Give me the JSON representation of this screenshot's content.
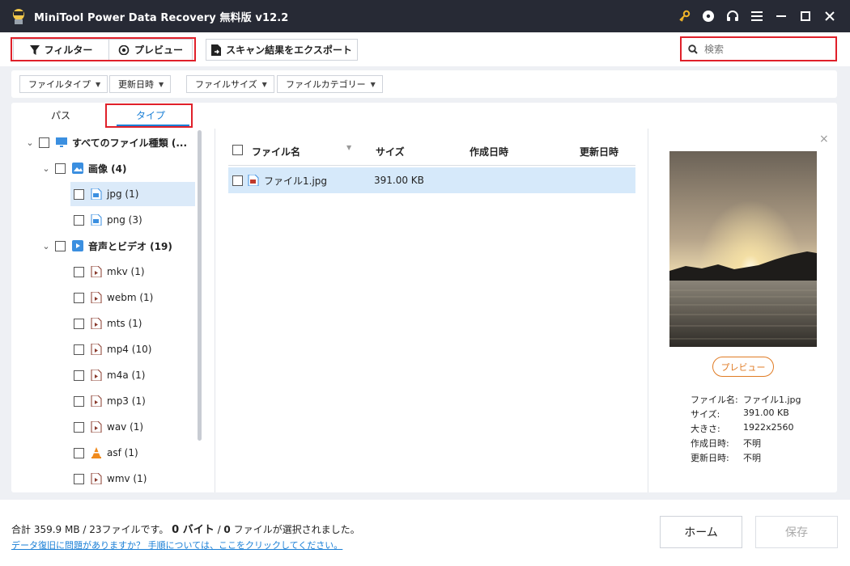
{
  "app": {
    "title": "MiniTool Power Data Recovery 無料版 v12.2"
  },
  "toolbar": {
    "filter_label": "フィルター",
    "preview_label": "プレビュー",
    "export_label": "スキャン結果をエクスポート",
    "search_placeholder": "検索"
  },
  "filters": [
    {
      "label": "ファイルタイプ"
    },
    {
      "label": "更新日時"
    },
    {
      "label": "ファイルサイズ"
    },
    {
      "label": "ファイルカテゴリー"
    }
  ],
  "tabs": {
    "path": "パス",
    "type": "タイプ"
  },
  "tree": {
    "root": "すべてのファイル種類 (...",
    "images": "画像 (4)",
    "jpg": "jpg (1)",
    "png": "png (3)",
    "av": "音声とビデオ (19)",
    "mkv": "mkv (1)",
    "webm": "webm (1)",
    "mts": "mts (1)",
    "mp4": "mp4 (10)",
    "m4a": "m4a (1)",
    "mp3": "mp3 (1)",
    "wav": "wav (1)",
    "asf": "asf (1)",
    "wmv": "wmv (1)"
  },
  "list": {
    "headers": {
      "name": "ファイル名",
      "size": "サイズ",
      "created": "作成日時",
      "modified": "更新日時"
    },
    "rows": [
      {
        "name": "ファイル1.jpg",
        "size": "391.00 KB",
        "created": "",
        "modified": ""
      }
    ]
  },
  "preview": {
    "button": "プレビュー",
    "labels": {
      "name": "ファイル名:",
      "size": "サイズ:",
      "dims": "大きさ:",
      "created": "作成日時:",
      "modified": "更新日時:"
    },
    "values": {
      "name": "ファイル1.jpg",
      "size": "391.00 KB",
      "dims": "1922x2560",
      "created": "不明",
      "modified": "不明"
    }
  },
  "footer": {
    "summary_prefix": "合計 ",
    "summary_total": "359.9 MB",
    "summary_sep": " / ",
    "summary_files": "23",
    "summary_mid": "ファイルです。 ",
    "selected_bytes": "0 バイト",
    "summary_sep2": " / ",
    "selected_files": "0",
    "summary_end": " ファイルが選択されました。",
    "help_link": "データ復旧に問題がありますか？ 手順については、ここをクリックしてください。",
    "home_button": "ホーム",
    "save_button": "保存"
  },
  "colors": {
    "accent": "#1a7fd6",
    "highlight": "#e0202a",
    "preview_orange": "#e07b24",
    "titlebar": "#272a35"
  }
}
